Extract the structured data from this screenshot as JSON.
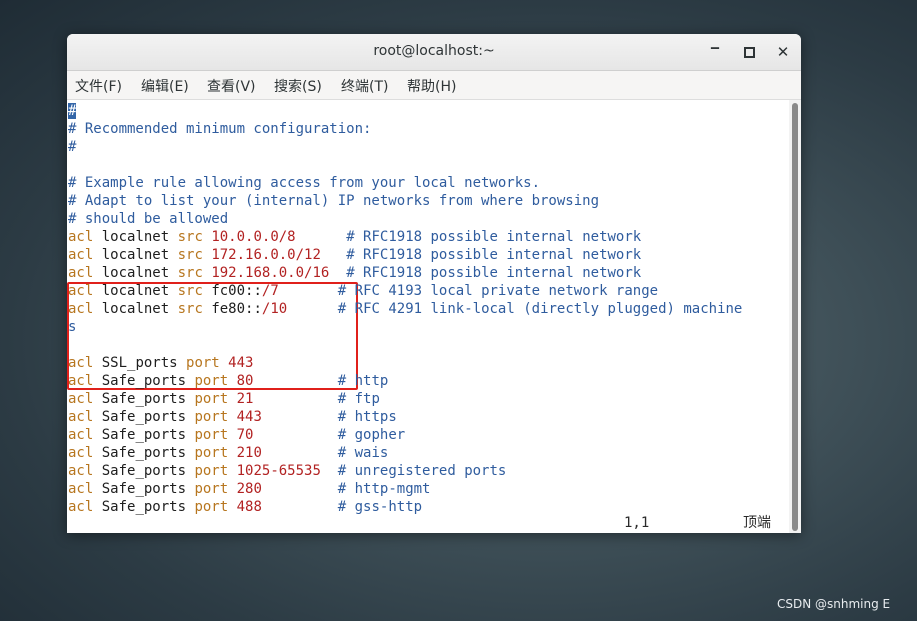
{
  "window": {
    "title": "root@localhost:~",
    "minimize_glyph": "‒",
    "close_glyph": "✕"
  },
  "menu": [
    "文件(F)",
    "编辑(E)",
    "查看(V)",
    "搜索(S)",
    "终端(T)",
    "帮助(H)"
  ],
  "terminal": {
    "lines": [
      [
        [
          "cursor",
          "#"
        ]
      ],
      [
        [
          "cmt",
          "# Recommended minimum configuration:"
        ]
      ],
      [
        [
          "cmt",
          "#"
        ]
      ],
      [],
      [
        [
          "cmt",
          "# Example rule allowing access from your local networks."
        ]
      ],
      [
        [
          "cmt",
          "# Adapt to list your (internal) IP networks from where browsing"
        ]
      ],
      [
        [
          "cmt",
          "# should be allowed"
        ]
      ],
      [
        [
          "kw",
          "acl"
        ],
        [
          "txt",
          " localnet "
        ],
        [
          "kw",
          "src"
        ],
        [
          "txt",
          " "
        ],
        [
          "num",
          "10.0.0.0/8"
        ],
        [
          "txt",
          "      "
        ],
        [
          "cmt",
          "# RFC1918 possible internal network"
        ]
      ],
      [
        [
          "kw",
          "acl"
        ],
        [
          "txt",
          " localnet "
        ],
        [
          "kw",
          "src"
        ],
        [
          "txt",
          " "
        ],
        [
          "num",
          "172.16.0.0/12"
        ],
        [
          "txt",
          "   "
        ],
        [
          "cmt",
          "# RFC1918 possible internal network"
        ]
      ],
      [
        [
          "kw",
          "acl"
        ],
        [
          "txt",
          " localnet "
        ],
        [
          "kw",
          "src"
        ],
        [
          "txt",
          " "
        ],
        [
          "num",
          "192.168.0.0/16"
        ],
        [
          "txt",
          "  "
        ],
        [
          "cmt",
          "# RFC1918 possible internal network"
        ]
      ],
      [
        [
          "kw",
          "acl"
        ],
        [
          "txt",
          " localnet "
        ],
        [
          "kw",
          "src"
        ],
        [
          "txt",
          " fc00::"
        ],
        [
          "num",
          "/7"
        ],
        [
          "txt",
          "       "
        ],
        [
          "cmt",
          "# RFC 4193 local private network range"
        ]
      ],
      [
        [
          "kw",
          "acl"
        ],
        [
          "txt",
          " localnet "
        ],
        [
          "kw",
          "src"
        ],
        [
          "txt",
          " fe80::"
        ],
        [
          "num",
          "/10"
        ],
        [
          "txt",
          "      "
        ],
        [
          "cmt",
          "# RFC 4291 link-local (directly plugged) machine"
        ]
      ],
      [
        [
          "cmt",
          "s"
        ]
      ],
      [],
      [
        [
          "kw",
          "acl"
        ],
        [
          "txt",
          " SSL_ports "
        ],
        [
          "kw",
          "port"
        ],
        [
          "txt",
          " "
        ],
        [
          "num",
          "443"
        ]
      ],
      [
        [
          "kw",
          "acl"
        ],
        [
          "txt",
          " Safe_ports "
        ],
        [
          "kw",
          "port"
        ],
        [
          "txt",
          " "
        ],
        [
          "num",
          "80"
        ],
        [
          "txt",
          "          "
        ],
        [
          "cmt",
          "# http"
        ]
      ],
      [
        [
          "kw",
          "acl"
        ],
        [
          "txt",
          " Safe_ports "
        ],
        [
          "kw",
          "port"
        ],
        [
          "txt",
          " "
        ],
        [
          "num",
          "21"
        ],
        [
          "txt",
          "          "
        ],
        [
          "cmt",
          "# ftp"
        ]
      ],
      [
        [
          "kw",
          "acl"
        ],
        [
          "txt",
          " Safe_ports "
        ],
        [
          "kw",
          "port"
        ],
        [
          "txt",
          " "
        ],
        [
          "num",
          "443"
        ],
        [
          "txt",
          "         "
        ],
        [
          "cmt",
          "# https"
        ]
      ],
      [
        [
          "kw",
          "acl"
        ],
        [
          "txt",
          " Safe_ports "
        ],
        [
          "kw",
          "port"
        ],
        [
          "txt",
          " "
        ],
        [
          "num",
          "70"
        ],
        [
          "txt",
          "          "
        ],
        [
          "cmt",
          "# gopher"
        ]
      ],
      [
        [
          "kw",
          "acl"
        ],
        [
          "txt",
          " Safe_ports "
        ],
        [
          "kw",
          "port"
        ],
        [
          "txt",
          " "
        ],
        [
          "num",
          "210"
        ],
        [
          "txt",
          "         "
        ],
        [
          "cmt",
          "# wais"
        ]
      ],
      [
        [
          "kw",
          "acl"
        ],
        [
          "txt",
          " Safe_ports "
        ],
        [
          "kw",
          "port"
        ],
        [
          "txt",
          " "
        ],
        [
          "num",
          "1025-65535"
        ],
        [
          "txt",
          "  "
        ],
        [
          "cmt",
          "# unregistered ports"
        ]
      ],
      [
        [
          "kw",
          "acl"
        ],
        [
          "txt",
          " Safe_ports "
        ],
        [
          "kw",
          "port"
        ],
        [
          "txt",
          " "
        ],
        [
          "num",
          "280"
        ],
        [
          "txt",
          "         "
        ],
        [
          "cmt",
          "# http-mgmt"
        ]
      ],
      [
        [
          "kw",
          "acl"
        ],
        [
          "txt",
          " Safe_ports "
        ],
        [
          "kw",
          "port"
        ],
        [
          "txt",
          " "
        ],
        [
          "num",
          "488"
        ],
        [
          "txt",
          "         "
        ],
        [
          "cmt",
          "# gss-http"
        ]
      ]
    ],
    "status_position": "1,1",
    "status_scroll": "顶端"
  },
  "colors": {
    "comment": "#2f5c9e",
    "keyword": "#b7761f",
    "number": "#b22222",
    "highlight_box": "#e0201b"
  },
  "watermark": "CSDN @snhming E"
}
